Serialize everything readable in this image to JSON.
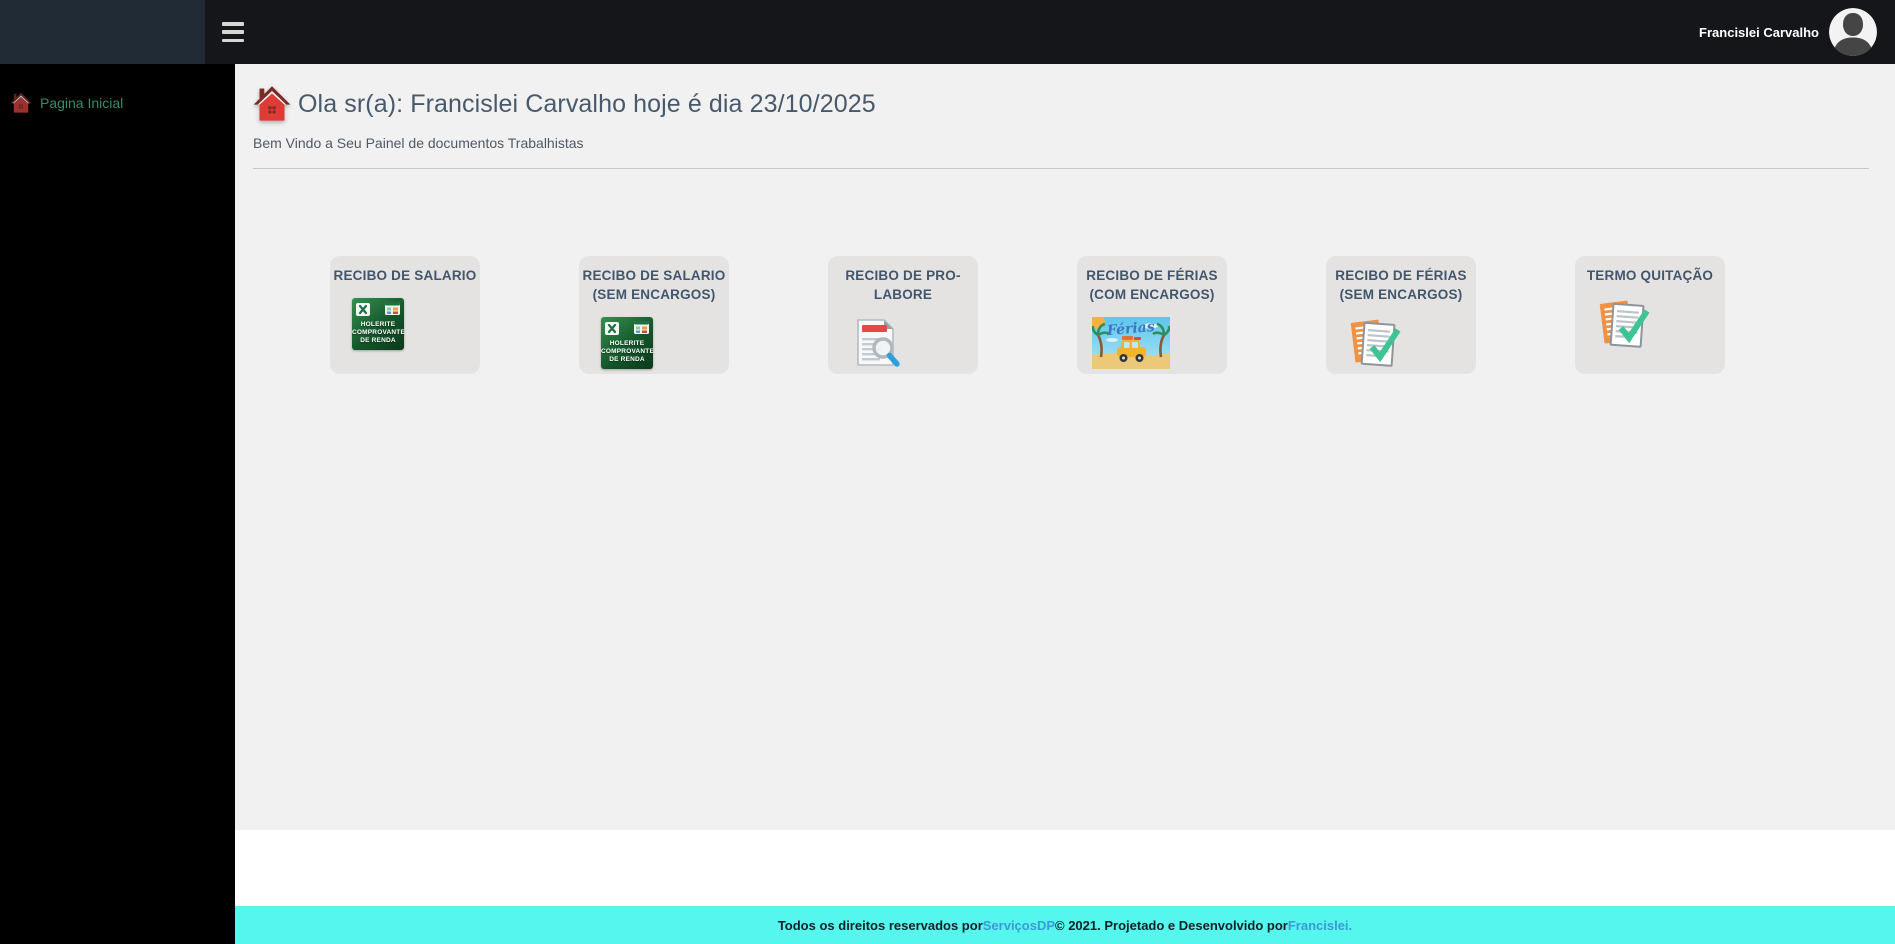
{
  "topbar": {
    "user_name": "Francislei Carvalho"
  },
  "sidebar": {
    "items": [
      {
        "label": "Pagina Inicial"
      }
    ]
  },
  "header": {
    "title": "Ola sr(a): Francislei Carvalho hoje é dia 23/10/2025",
    "subtitle": "Bem Vindo a Seu Painel de documentos Trabalhistas",
    "date": "23/10/2025"
  },
  "cards": [
    {
      "line1": "RECIBO DE SALARIO",
      "line2": "",
      "icon": "holerite-icon"
    },
    {
      "line1": "RECIBO DE SALARIO",
      "line2": "(SEM ENCARGOS)",
      "icon": "holerite-icon"
    },
    {
      "line1": "RECIBO DE PRO-",
      "line2": "LABORE",
      "icon": "document-search-icon"
    },
    {
      "line1": "RECIBO DE FÉRIAS",
      "line2": "(COM ENCARGOS)",
      "icon": "ferias-beach-icon"
    },
    {
      "line1": "RECIBO DE FÉRIAS",
      "line2": "(SEM ENCARGOS)",
      "icon": "document-check-icon"
    },
    {
      "line1": "TERMO QUITAÇÃO",
      "line2": "",
      "icon": "document-check-icon"
    }
  ],
  "icons": {
    "holerite_lines": [
      "HOLERITE",
      "COMPROVANTE",
      "DE RENDA"
    ],
    "ferias_label": "Férias"
  },
  "footer": {
    "text1": "Todos os direitos reservados por ",
    "link1": "ServiçosDP",
    "text2": " © 2021. Projetado e Desenvolvido por ",
    "link2": "Francislei."
  },
  "colors": {
    "topbar_bg": "#15161a",
    "brand_bg": "#202b36",
    "sidebar_bg": "#000000",
    "sidebar_link": "#2f8e6f",
    "content_bg": "#f1f1f1",
    "card_bg": "#e4e3e1",
    "card_title": "#40566d",
    "heading": "#48596b",
    "footer_bg": "#55f6ee",
    "footer_link": "#3a9bd5",
    "home_icon_red": "#dd3b33",
    "home_icon_roof": "#7c2b28"
  }
}
